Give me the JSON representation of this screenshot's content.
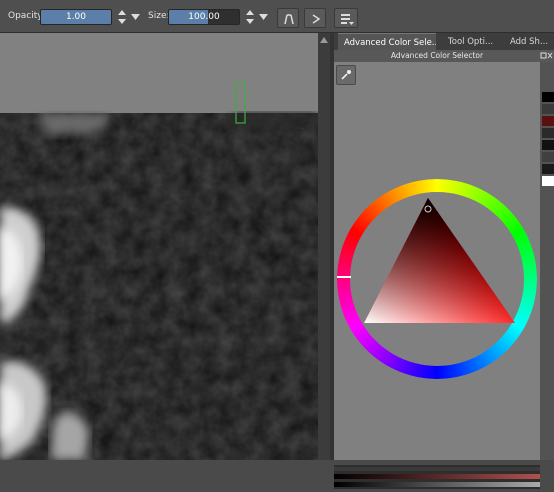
{
  "toolbar": {
    "opacity_label": "Opacity:",
    "opacity_value": "1.00",
    "opacity_fraction": 1.0,
    "size_label": "Size:",
    "size_value": "100.00",
    "size_fraction": 0.55
  },
  "tabs": [
    {
      "label": "Advanced Color Sele...",
      "active": true
    },
    {
      "label": "Tool Opti...",
      "active": false
    },
    {
      "label": "Add Sh...",
      "active": false
    }
  ],
  "panel": {
    "title": "Advanced Color Selector"
  },
  "colors": {
    "accent": "#5b7fa8",
    "history": [
      "#000000",
      "#3a3a3a",
      "#5a1010",
      "#2a2a2a",
      "#111111",
      "#404040",
      "#1a1a1a",
      "#ffffff"
    ]
  },
  "icons": [
    "wrap-around-icon",
    "mirror-icon",
    "workspace-icon",
    "color-picker-icon"
  ]
}
